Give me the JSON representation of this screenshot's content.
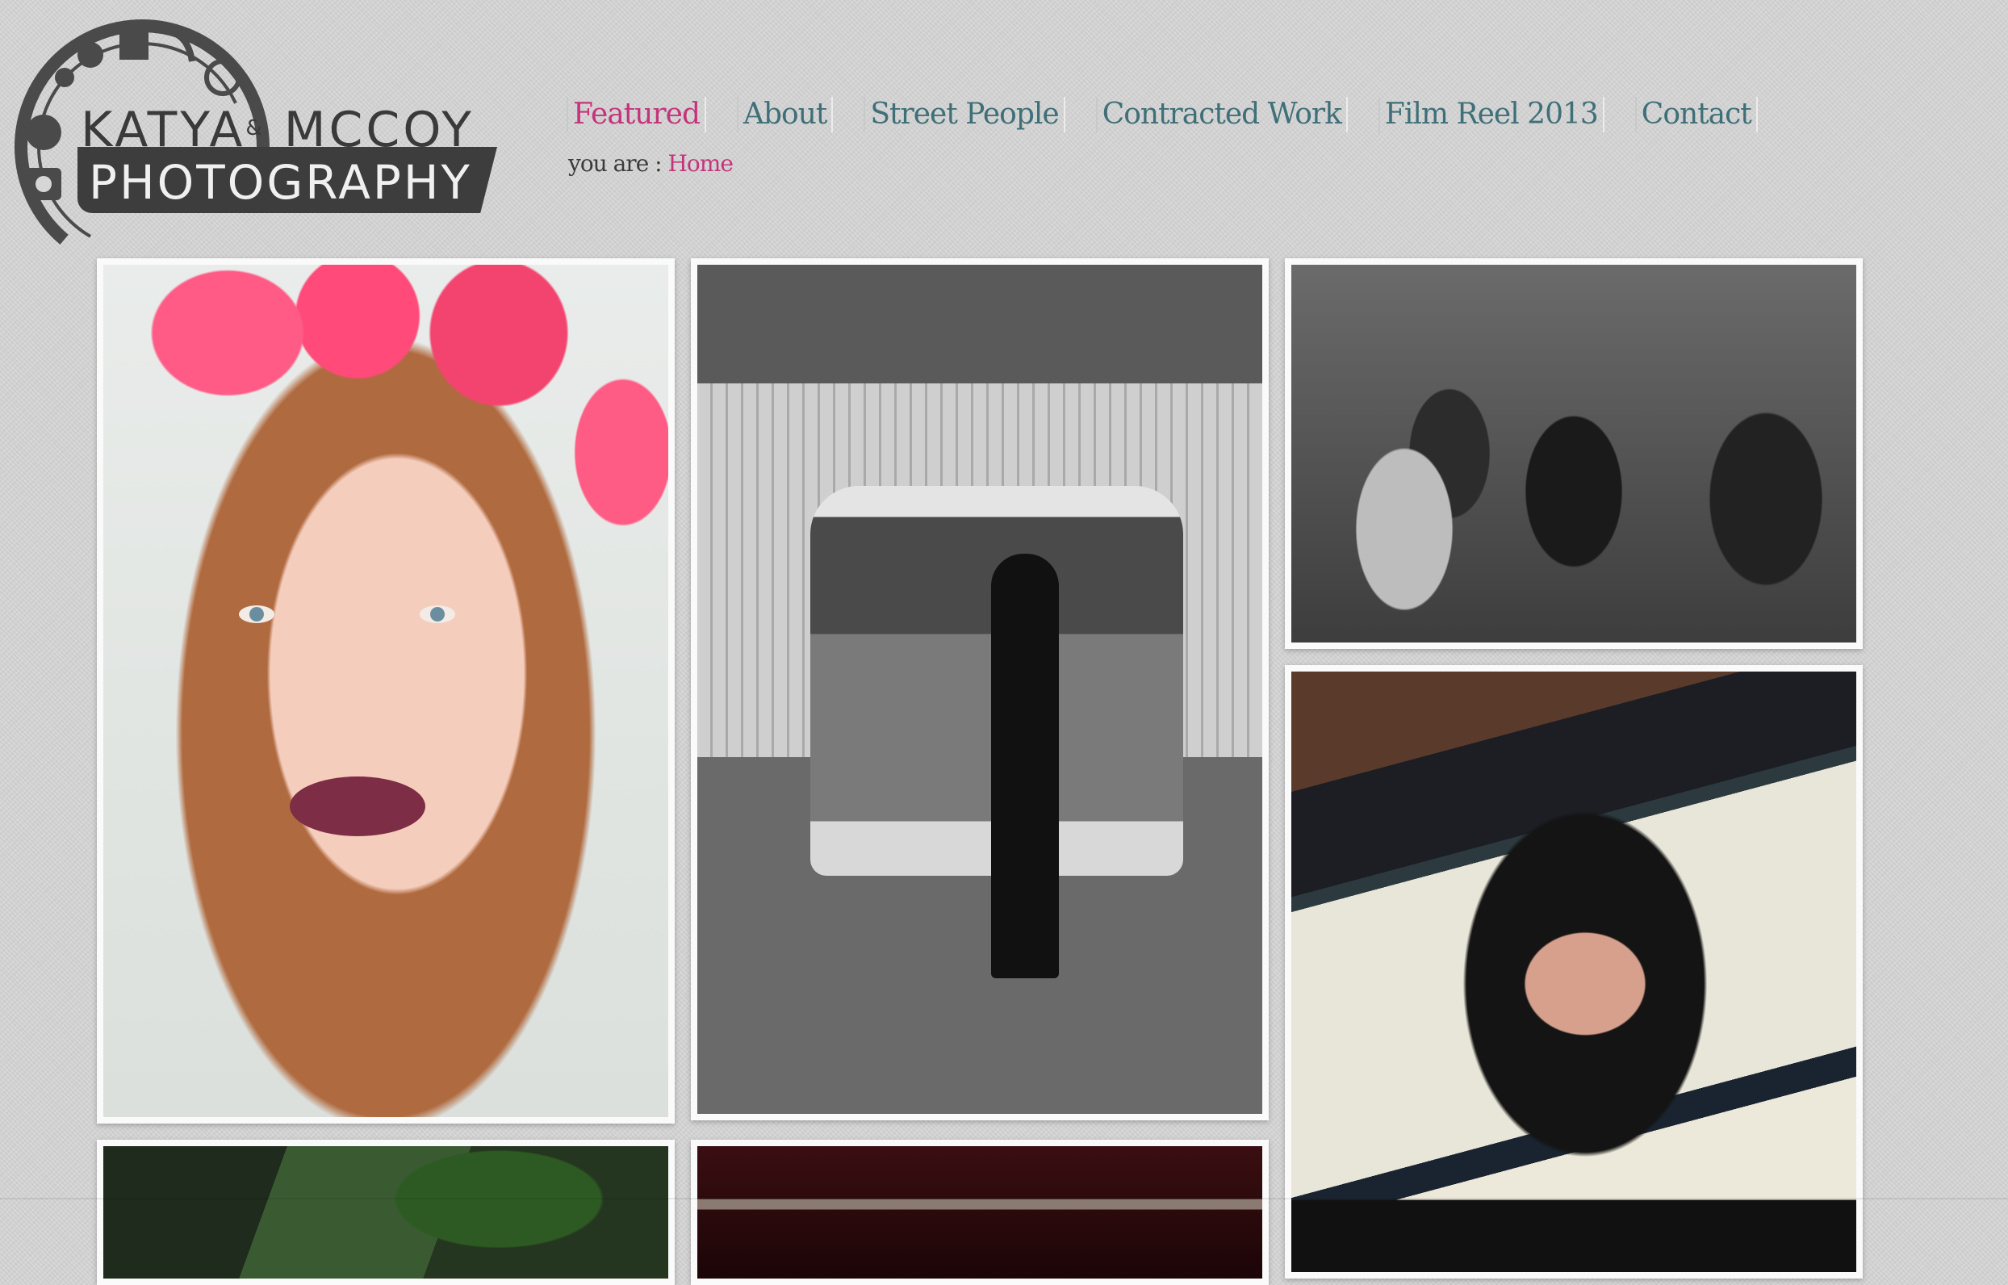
{
  "site": {
    "logo": {
      "line1": "KATYA",
      "joiner": "&",
      "line1b": "MCCOY",
      "line2": "PHOTOGRAPHY"
    }
  },
  "nav": {
    "items": [
      {
        "label": "Featured",
        "active": true
      },
      {
        "label": "About",
        "active": false
      },
      {
        "label": "Street People",
        "active": false
      },
      {
        "label": "Contracted Work",
        "active": false
      },
      {
        "label": "Film Reel 2013",
        "active": false
      },
      {
        "label": "Contact",
        "active": false
      }
    ]
  },
  "breadcrumb": {
    "prefix": "you are :",
    "current": "Home"
  },
  "colors": {
    "accent": "#c4347c",
    "nav_text": "#3f6f78",
    "background": "#d6d6d6"
  },
  "gallery": {
    "items": [
      {
        "subject": "redhead portrait with pink flower crown"
      },
      {
        "subject": "woman in black dress posing on vintage van, black and white"
      },
      {
        "subject": "street crowd, black and white"
      },
      {
        "subject": "woman with headphones under wooden canopy"
      },
      {
        "subject": "green foliage and metal railing"
      },
      {
        "subject": "hangers on rail, dark red tone"
      }
    ]
  }
}
